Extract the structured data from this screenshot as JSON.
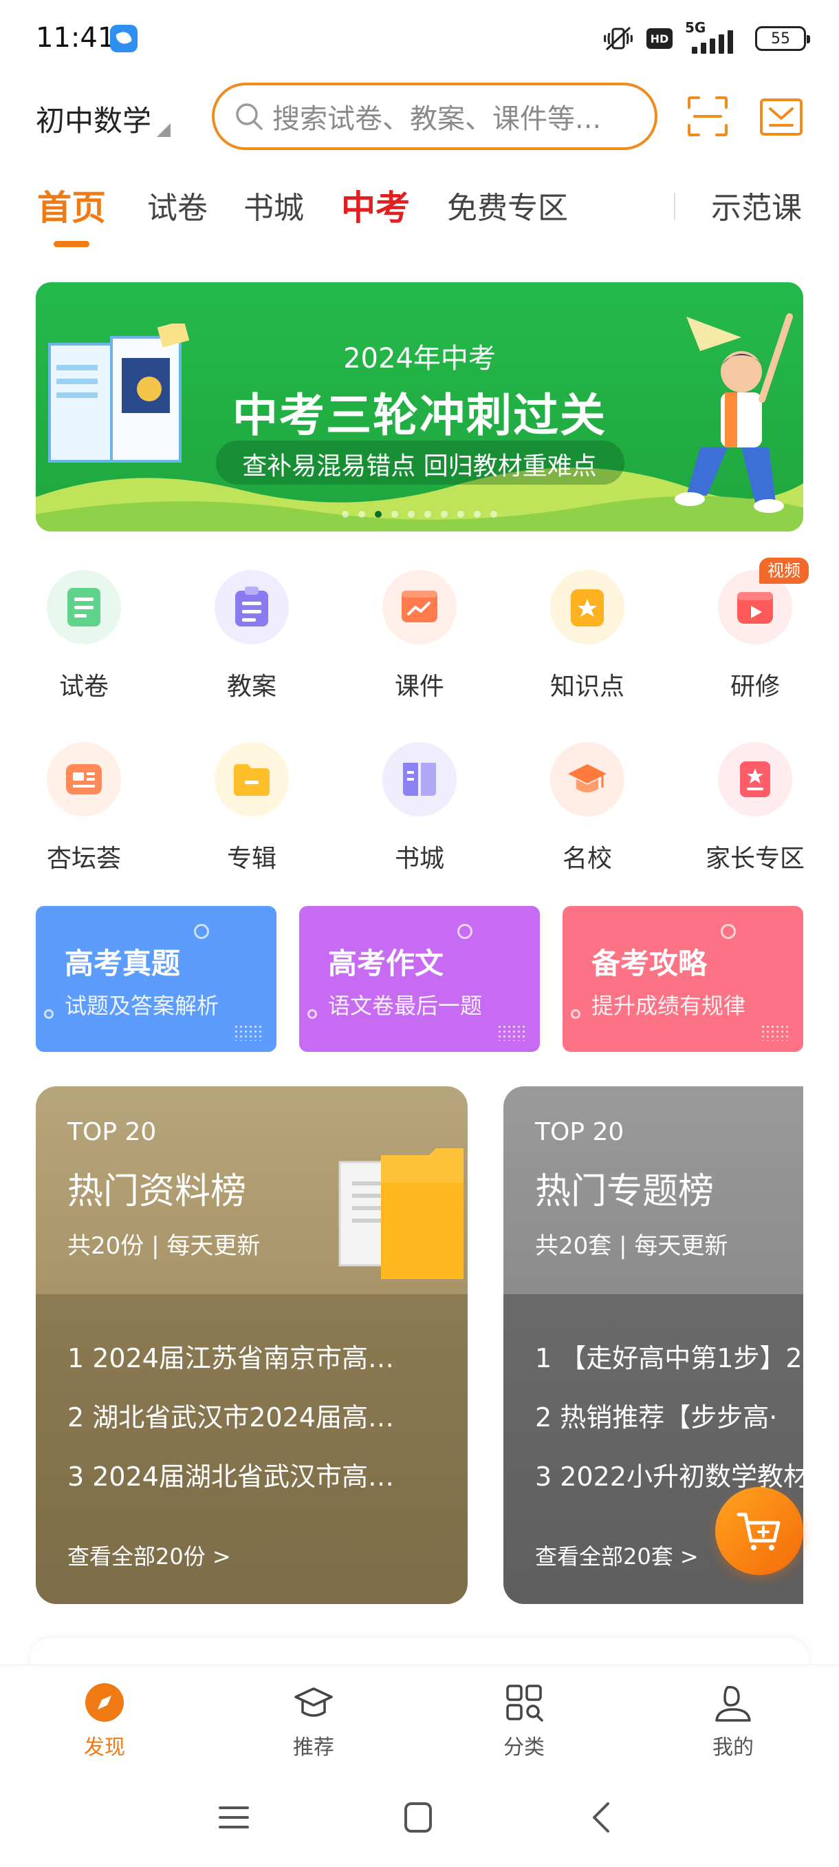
{
  "status_bar": {
    "time": "11:41",
    "network": "5G",
    "hd": "HD",
    "battery": "55"
  },
  "header": {
    "subject": "初中数学",
    "search_placeholder": "搜索试卷、教案、课件等...",
    "icons": [
      "scan-icon",
      "mail-icon"
    ]
  },
  "tabs": [
    {
      "label": "首页",
      "state": "active"
    },
    {
      "label": "试卷",
      "state": "normal"
    },
    {
      "label": "书城",
      "state": "normal"
    },
    {
      "label": "中考",
      "state": "hot"
    },
    {
      "label": "免费专区",
      "state": "normal"
    },
    {
      "label": "示范课",
      "state": "normal"
    }
  ],
  "banner": {
    "year_text": "2024年中考",
    "title": "中考三轮冲刺过关",
    "subtitle": "查补易混易错点 回归教材重难点",
    "dot_count": 10,
    "active_dot": 3
  },
  "grid": [
    {
      "label": "试卷",
      "icon": "exam-paper-icon",
      "color": "#5fd38a"
    },
    {
      "label": "教案",
      "icon": "lesson-plan-icon",
      "color": "#8a7cf0"
    },
    {
      "label": "课件",
      "icon": "courseware-icon",
      "color": "#ff7a4d"
    },
    {
      "label": "知识点",
      "icon": "knowledge-star-icon",
      "color": "#ffb21f"
    },
    {
      "label": "研修",
      "icon": "video-play-icon",
      "color": "#ff5a5a",
      "badge": "视频"
    },
    {
      "label": "杏坛荟",
      "icon": "news-card-icon",
      "color": "#ff8a57"
    },
    {
      "label": "专辑",
      "icon": "folder-icon",
      "color": "#ffbf2a"
    },
    {
      "label": "书城",
      "icon": "book-icon",
      "color": "#8c82f2"
    },
    {
      "label": "名校",
      "icon": "graduation-cap-icon",
      "color": "#ff7b3d"
    },
    {
      "label": "家长专区",
      "icon": "parent-star-icon",
      "color": "#ff5c6a"
    }
  ],
  "promos": [
    {
      "title": "高考真题",
      "subtitle": "试题及答案解析",
      "color": "#5b9cfd"
    },
    {
      "title": "高考作文",
      "subtitle": "语文卷最后一题",
      "color": "#c76cf2"
    },
    {
      "title": "备考攻略",
      "subtitle": "提升成绩有规律",
      "color": "#fb7384"
    }
  ],
  "rankings": [
    {
      "kicker": "TOP 20",
      "title": "热门资料榜",
      "meta": "共20份 | 每天更新",
      "items": [
        "1 2024届江苏省南京市高…",
        "2 湖北省武汉市2024届高…",
        "3 2024届湖北省武汉市高…"
      ],
      "more": "查看全部20份 >"
    },
    {
      "kicker": "TOP 20",
      "title": "热门专题榜",
      "meta": "共20套 | 每天更新",
      "items": [
        "1 【走好高中第1步】2",
        "2 热销推荐【步步高·",
        "3 2022小升初数学教材"
      ],
      "more": "查看全部20套 >"
    }
  ],
  "bottom_nav": [
    {
      "label": "发现",
      "icon": "discover-icon",
      "active": true
    },
    {
      "label": "推荐",
      "icon": "recommend-cap-icon",
      "active": false
    },
    {
      "label": "分类",
      "icon": "category-grid-icon",
      "active": false
    },
    {
      "label": "我的",
      "icon": "profile-icon",
      "active": false
    }
  ],
  "colors": {
    "accent": "#f07b14",
    "hot_tab": "#e21f1f",
    "banner_green": "#25b94b"
  }
}
